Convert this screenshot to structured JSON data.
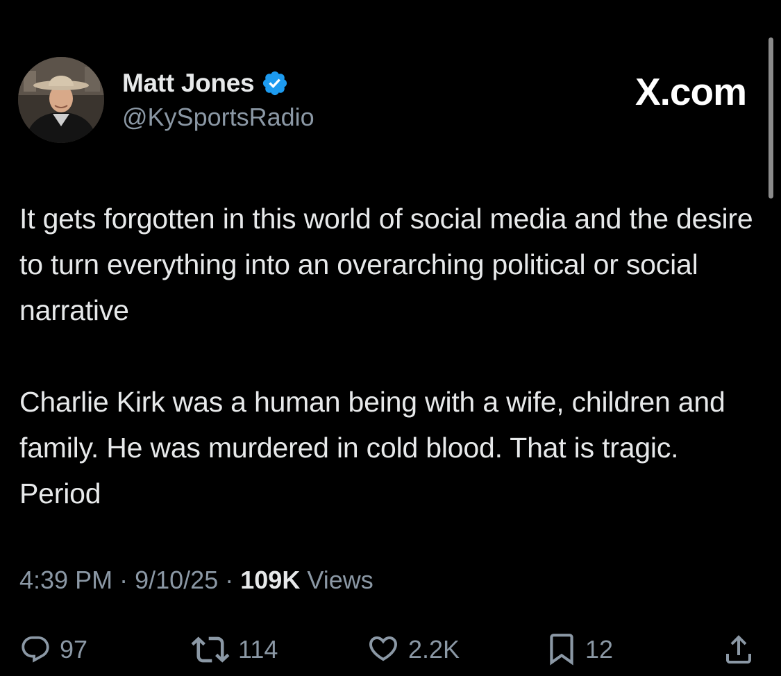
{
  "author": {
    "display_name": "Matt Jones",
    "handle": "@KySportsRadio",
    "verified": true
  },
  "brand": "X.com",
  "tweet": {
    "paragraphs": [
      "It gets forgotten in this world of social media and the desire to turn everything into an overarching political or social narrative",
      "Charlie Kirk was a human being with a wife, children and family. He was murdered in cold blood. That is tragic. Period"
    ]
  },
  "meta": {
    "time": "4:39 PM",
    "separator": "·",
    "date": "9/10/25",
    "views_count": "109K",
    "views_label": "Views"
  },
  "actions": {
    "replies": "97",
    "reposts": "114",
    "likes": "2.2K",
    "bookmarks": "12"
  },
  "icons": {
    "reply": "reply-bubble-icon",
    "repost": "repost-arrows-icon",
    "like": "heart-icon",
    "bookmark": "bookmark-icon",
    "share": "share-icon",
    "verified": "verified-badge-icon"
  },
  "colors": {
    "background": "#000000",
    "text_primary": "#e7e9ea",
    "text_secondary": "#8b98a5",
    "verified_blue": "#1d9bf0"
  }
}
